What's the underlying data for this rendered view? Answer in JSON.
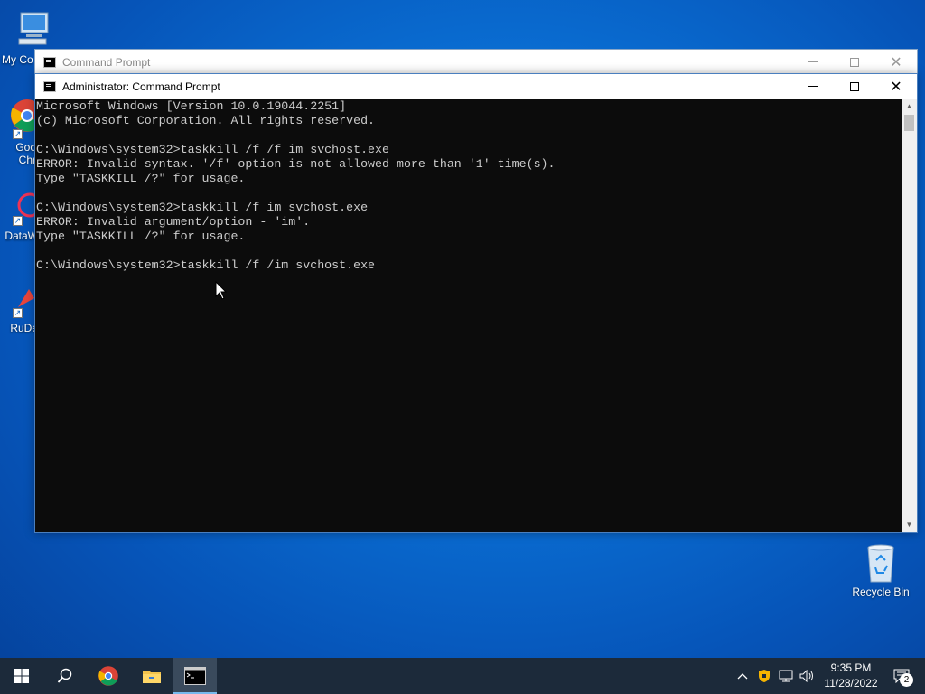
{
  "desktop": {
    "icons": [
      {
        "label": "My Co",
        "icon": "computer-icon"
      },
      {
        "label": "Goo\nChr",
        "icon": "chrome-icon"
      },
      {
        "label": "DataW",
        "icon": "datawrapper-icon"
      },
      {
        "label": "RuDe",
        "icon": "rudesktop-icon"
      },
      {
        "label": "Recycle Bin",
        "icon": "recycle-bin-icon"
      }
    ]
  },
  "windows": {
    "back": {
      "title": "Command Prompt"
    },
    "front": {
      "title": "Administrator: Command Prompt"
    }
  },
  "console": {
    "lines": [
      "Microsoft Windows [Version 10.0.19044.2251]",
      "(c) Microsoft Corporation. All rights reserved.",
      "",
      "C:\\Windows\\system32>taskkill /f /f im svchost.exe",
      "ERROR: Invalid syntax. '/f' option is not allowed more than '1' time(s).",
      "Type \"TASKKILL /?\" for usage.",
      "",
      "C:\\Windows\\system32>taskkill /f im svchost.exe",
      "ERROR: Invalid argument/option - 'im'.",
      "Type \"TASKKILL /?\" for usage.",
      "",
      "C:\\Windows\\system32>taskkill /f /im svchost.exe"
    ]
  },
  "taskbar": {
    "items": [
      "start-icon",
      "search-icon",
      "chrome-icon",
      "file-explorer-icon",
      "command-prompt-icon"
    ],
    "clock": {
      "time": "9:35 PM",
      "date": "11/28/2022"
    },
    "notification_count": "2"
  },
  "colors": {
    "console_bg": "#0c0c0c",
    "console_fg": "#cccccc",
    "taskbar": "#1c2a3a"
  }
}
